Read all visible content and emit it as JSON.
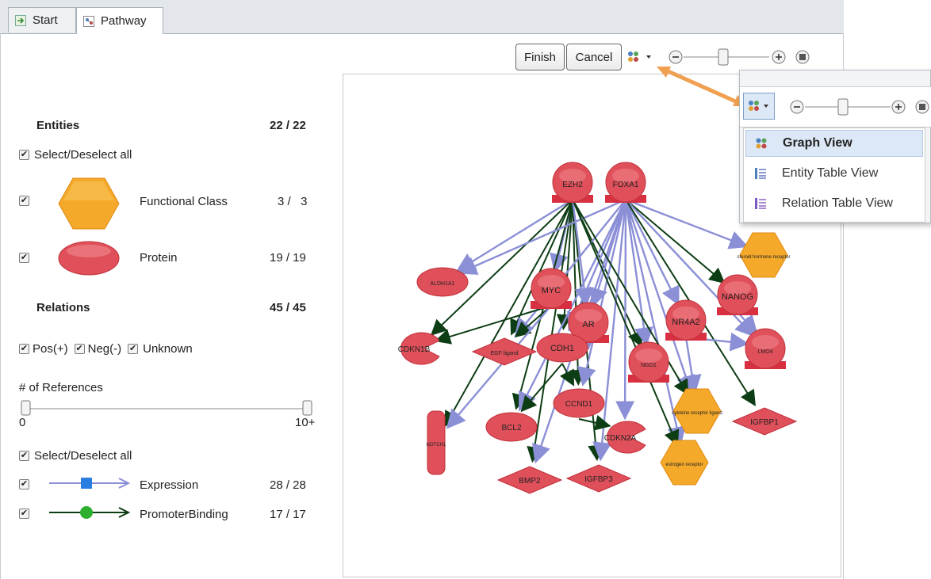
{
  "tabs": {
    "start": "Start",
    "pathway": "Pathway"
  },
  "toolbar": {
    "finish": "Finish",
    "cancel": "Cancel"
  },
  "entities": {
    "title": "Entities",
    "count": "22 / 22",
    "select_all": "Select/Deselect all",
    "functional_class": {
      "label": "Functional Class",
      "count": "3 /   3"
    },
    "protein": {
      "label": "Protein",
      "count": "19 / 19"
    }
  },
  "relations": {
    "title": "Relations",
    "count": "45 / 45",
    "pos": "Pos(+)",
    "neg": "Neg(-)",
    "unknown": "Unknown",
    "references_label": "# of References",
    "slider_min": "0",
    "slider_max": "10+",
    "select_all": "Select/Deselect all",
    "expression": {
      "label": "Expression",
      "count": "28 / 28"
    },
    "promoter_binding": {
      "label": "PromoterBinding",
      "count": "17 / 17"
    }
  },
  "view_menu": {
    "graph_view": "Graph View",
    "entity_table_view": "Entity Table View",
    "relation_table_view": "Relation Table View"
  },
  "colors": {
    "protein": "#e0505a",
    "functional_class": "#f4a92a",
    "expression": "#8b8fd6",
    "promoter": "#0d3d14",
    "arrow": "#f0a050"
  },
  "graph": {
    "nodes": [
      "EZH2",
      "FOXA1",
      "ALDH1A1",
      "MYC",
      "steroid hormone receptor",
      "NANOG",
      "NR4A2",
      "CDKN1B",
      "AR",
      "EGF ligand",
      "CDH1",
      "NGO1",
      "LMO4",
      "CCND1",
      "cytokine receptor ligand",
      "IGFBP1",
      "BCL2",
      "CDKN2A",
      "NOTCH1",
      "estrogen receptor",
      "BMP2",
      "IGFBP3"
    ]
  }
}
